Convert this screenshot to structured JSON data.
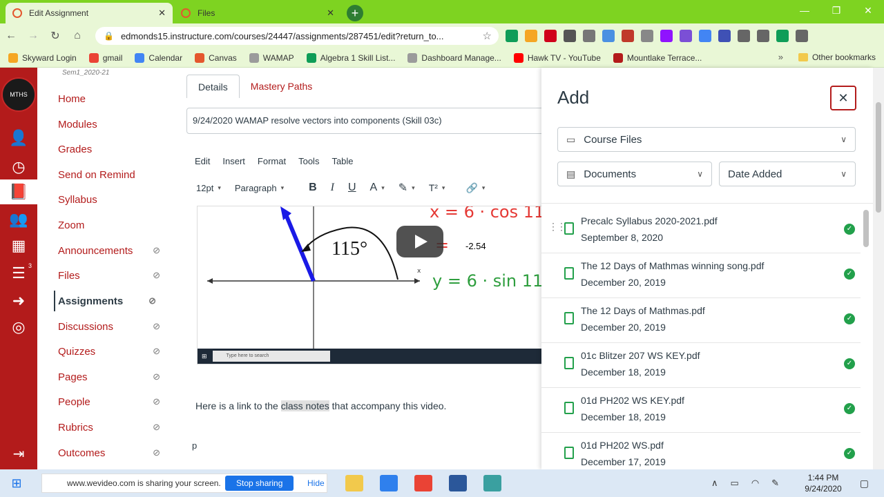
{
  "browser": {
    "tabs": [
      {
        "title": "Edit Assignment",
        "active": true
      },
      {
        "title": "Files",
        "active": false
      }
    ],
    "url": "edmonds15.instructure.com/courses/24447/assignments/287451/edit?return_to...",
    "bookmarks": [
      {
        "label": "Skyward Login",
        "color": "#f5a623"
      },
      {
        "label": "gmail",
        "color": "#ea4335"
      },
      {
        "label": "Calendar",
        "color": "#4285f4"
      },
      {
        "label": "Canvas",
        "color": "#e4572e"
      },
      {
        "label": "WAMAP",
        "color": "#9b9b9b"
      },
      {
        "label": "Algebra 1 Skill List...",
        "color": "#0f9d58"
      },
      {
        "label": "Dashboard Manage...",
        "color": "#9b9b9b"
      },
      {
        "label": "Hawk TV - YouTube",
        "color": "#ff0000"
      },
      {
        "label": "Mountlake Terrace...",
        "color": "#b31b1b"
      }
    ],
    "other_bookmarks": "Other bookmarks"
  },
  "global_nav": {
    "todo_badge": "3"
  },
  "course_nav": {
    "term": "Sem1_2020-21",
    "items": [
      {
        "label": "Home",
        "hidden": false
      },
      {
        "label": "Modules",
        "hidden": false
      },
      {
        "label": "Grades",
        "hidden": false
      },
      {
        "label": "Send on Remind",
        "hidden": false
      },
      {
        "label": "Syllabus",
        "hidden": false
      },
      {
        "label": "Zoom",
        "hidden": false
      },
      {
        "label": "Announcements",
        "hidden": true
      },
      {
        "label": "Files",
        "hidden": true
      },
      {
        "label": "Assignments",
        "hidden": true,
        "active": true
      },
      {
        "label": "Discussions",
        "hidden": true
      },
      {
        "label": "Quizzes",
        "hidden": true
      },
      {
        "label": "Pages",
        "hidden": true
      },
      {
        "label": "People",
        "hidden": true
      },
      {
        "label": "Rubrics",
        "hidden": true
      },
      {
        "label": "Outcomes",
        "hidden": true
      }
    ]
  },
  "editor": {
    "tabs": [
      "Details",
      "Mastery Paths"
    ],
    "title_value": "9/24/2020 WAMAP resolve vectors into components (Skill 03c)",
    "menu": [
      "Edit",
      "Insert",
      "Format",
      "Tools",
      "Table"
    ],
    "font_size": "12pt",
    "block_format": "Paragraph",
    "video_value": "-2.54",
    "video_search_placeholder": "Type here to search",
    "body_before": "Here is a link to the ",
    "body_link": "class notes",
    "body_after": " that accompany this video.",
    "body_p": "p"
  },
  "tray": {
    "title": "Add",
    "source": "Course Files",
    "content_type": "Documents",
    "sort": "Date Added",
    "files": [
      {
        "name": "Precalc Syllabus 2020-2021.pdf",
        "date": "September 8, 2020"
      },
      {
        "name": "The 12 Days of Mathmas winning song.pdf",
        "date": "December 20, 2019"
      },
      {
        "name": "The 12 Days of Mathmas.pdf",
        "date": "December 20, 2019"
      },
      {
        "name": "01c Blitzer 207 WS KEY.pdf",
        "date": "December 18, 2019"
      },
      {
        "name": "01d PH202 WS KEY.pdf",
        "date": "December 18, 2019"
      },
      {
        "name": "01d PH202 WS.pdf",
        "date": "December 17, 2019"
      }
    ]
  },
  "taskbar": {
    "share_text": "www.wevideo.com is sharing your screen.",
    "stop_label": "Stop sharing",
    "hide_label": "Hide",
    "time": "1:44 PM",
    "date": "9/24/2020"
  }
}
